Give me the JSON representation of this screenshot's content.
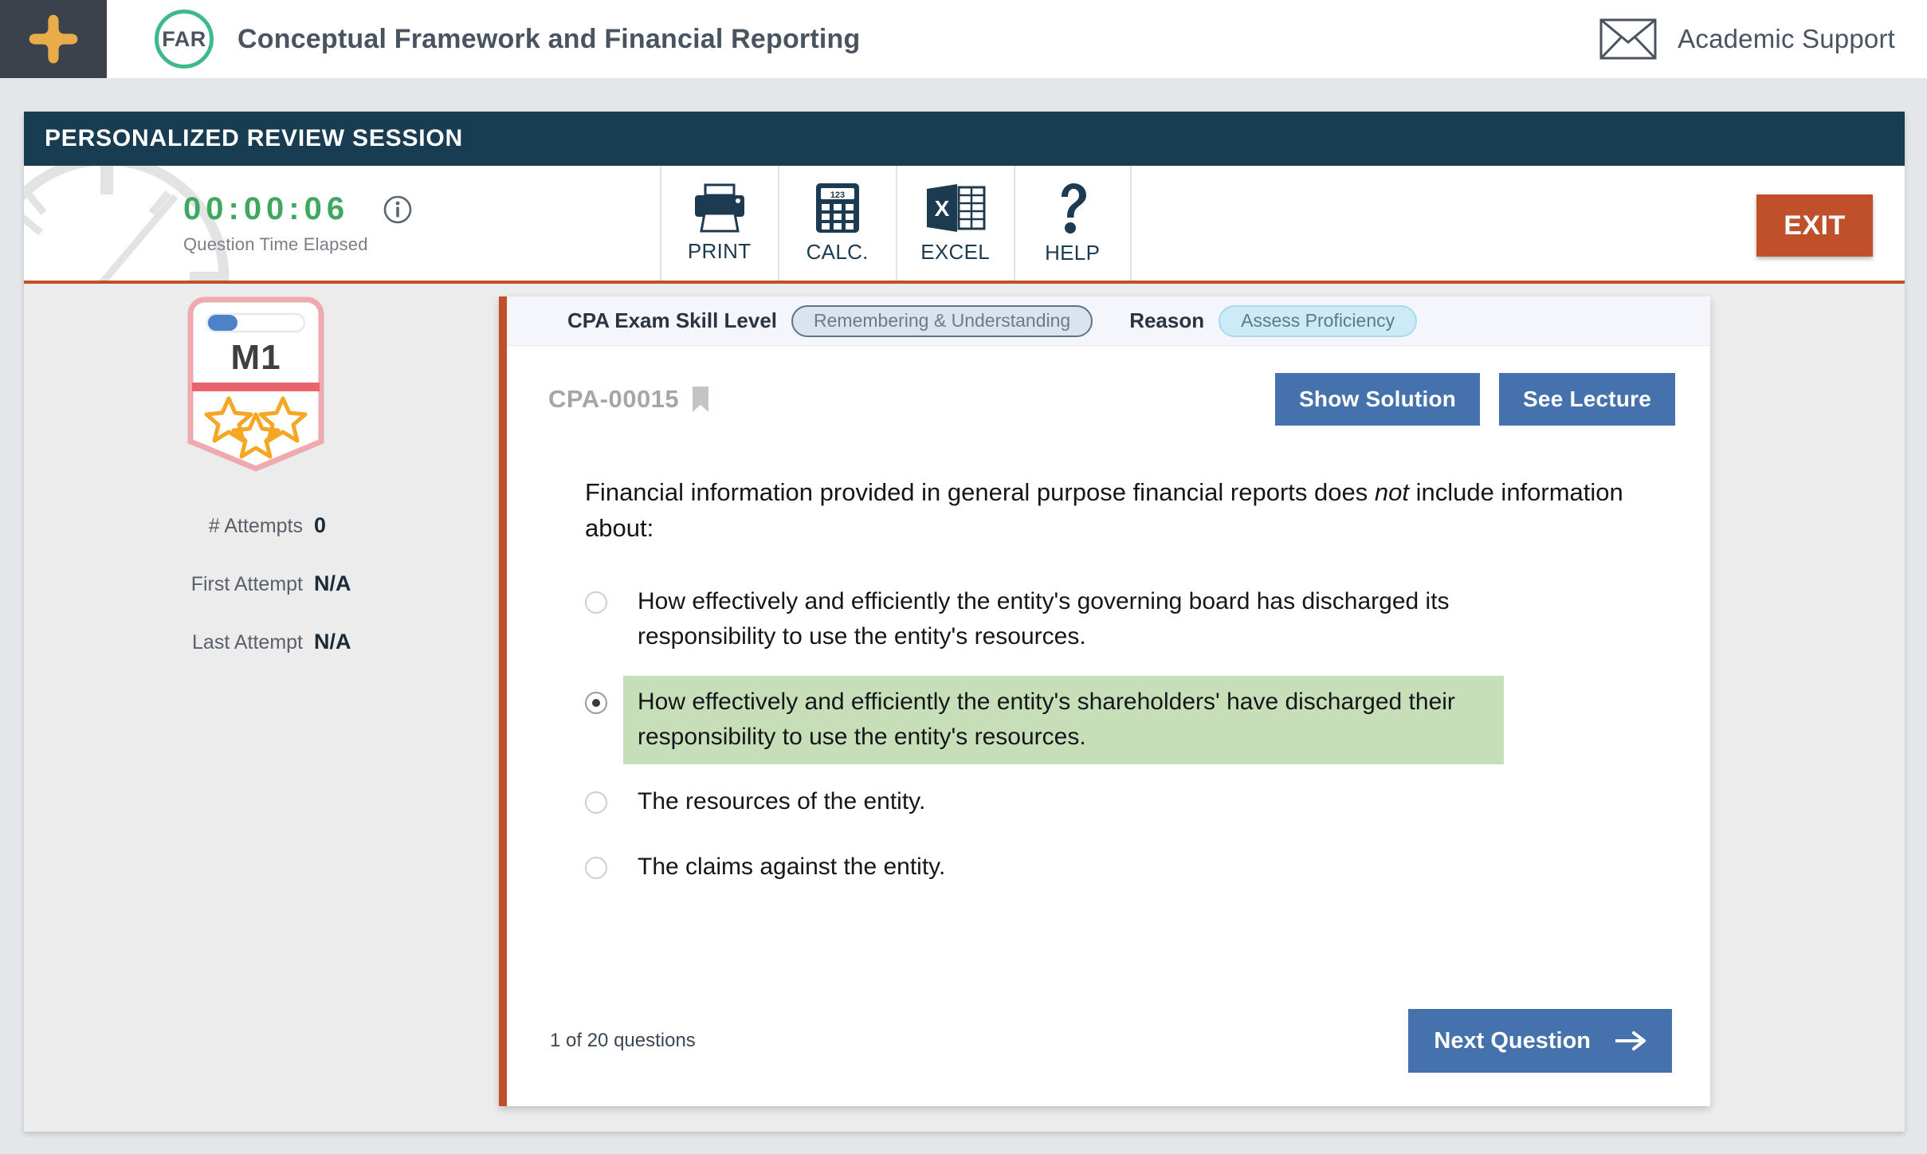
{
  "topbar": {
    "logo_icon": "plus-star-icon",
    "course_code": "FAR",
    "course_title": "Conceptual Framework and Financial Reporting",
    "support_icon": "envelope-icon",
    "support_label": "Academic Support",
    "logo_color": "#e9ac4b",
    "badge_color": "#3fb98a"
  },
  "session": {
    "title": "PERSONALIZED REVIEW SESSION",
    "bar_color": "#183d52"
  },
  "timer": {
    "value": "00:00:06",
    "label": "Question Time Elapsed",
    "info_icon": "info-icon",
    "clock_icon": "clock-watermark-icon",
    "value_color": "#3ea860"
  },
  "toolbar": {
    "items": [
      {
        "label": "PRINT",
        "icon": "printer-icon"
      },
      {
        "label": "CALC.",
        "icon": "calculator-icon"
      },
      {
        "label": "EXCEL",
        "icon": "excel-icon"
      },
      {
        "label": "HELP",
        "icon": "question-mark-icon"
      }
    ],
    "exit_label": "EXIT",
    "exit_color": "#c0502a"
  },
  "rail": {
    "badge_label": "M1",
    "badge_progress_percent": 12,
    "badge_stars": 3,
    "stats": [
      {
        "label": "# Attempts",
        "value": "0"
      },
      {
        "label": "First Attempt",
        "value": "N/A"
      },
      {
        "label": "Last Attempt",
        "value": "N/A"
      }
    ]
  },
  "question_card": {
    "skill_level_label": "CPA Exam Skill Level",
    "skill_level_value": "Remembering & Understanding",
    "reason_label": "Reason",
    "reason_value": "Assess Proficiency",
    "question_id": "CPA-00015",
    "bookmark_icon": "bookmark-icon",
    "show_solution_label": "Show Solution",
    "see_lecture_label": "See Lecture",
    "question_text_part1": "Financial information provided in general purpose financial reports does ",
    "question_text_italic": "not",
    "question_text_part2": " include information about:",
    "options": [
      {
        "text": "How effectively and efficiently the entity's governing board has discharged its responsibility to use the entity's resources.",
        "selected": false,
        "highlighted": false
      },
      {
        "text": "How effectively and efficiently the entity's shareholders' have discharged their responsibility to use the entity's resources.",
        "selected": true,
        "highlighted": true
      },
      {
        "text": "The resources of the entity.",
        "selected": false,
        "highlighted": false
      },
      {
        "text": "The claims against the entity.",
        "selected": false,
        "highlighted": false
      }
    ],
    "question_count": "1 of 20 questions",
    "next_label": "Next Question",
    "next_icon": "arrow-right-icon",
    "accent_color": "#c0502a",
    "button_color": "#4571ac",
    "highlight_color": "#c7dfb9"
  }
}
